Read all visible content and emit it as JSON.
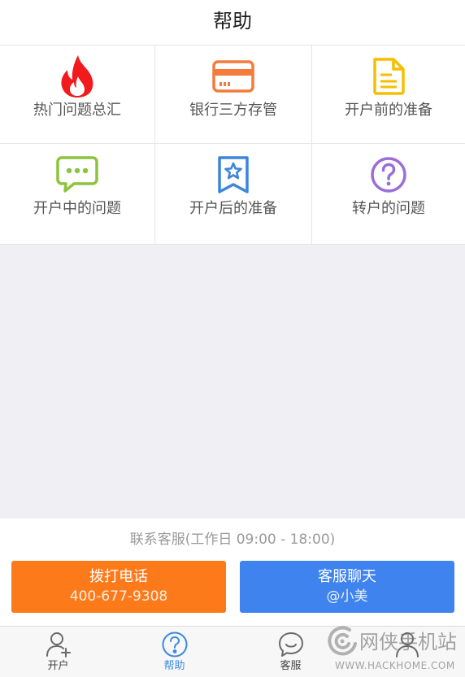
{
  "header": {
    "title": "帮助"
  },
  "categories": [
    {
      "label": "热门问题总汇",
      "icon": "fire-icon",
      "color": "#f21a1d"
    },
    {
      "label": "银行三方存管",
      "icon": "bank-card-icon",
      "color": "#f47b3c"
    },
    {
      "label": "开户前的准备",
      "icon": "document-icon",
      "color": "#f5bf00"
    },
    {
      "label": "开户中的问题",
      "icon": "chat-bubble-icon",
      "color": "#8cc43d"
    },
    {
      "label": "开户后的准备",
      "icon": "bookmark-star-icon",
      "color": "#3a86db"
    },
    {
      "label": "转户的问题",
      "icon": "question-circle-icon",
      "color": "#9a6ed8"
    }
  ],
  "contact": {
    "hours_text": "联系客服(工作日 09:00 - 18:00)",
    "call_button": {
      "title": "拨打电话",
      "subtitle": "400-677-9308",
      "color": "#fd7a1b"
    },
    "chat_button": {
      "title": "客服聊天",
      "subtitle": "@小美",
      "color": "#3f83ee"
    }
  },
  "tabbar": {
    "active_color": "#3a8ae6",
    "items": [
      {
        "label": "开户",
        "icon": "user-add-icon",
        "active": false
      },
      {
        "label": "帮助",
        "icon": "help-circle-icon",
        "active": true
      },
      {
        "label": "客服",
        "icon": "chat-smile-icon",
        "active": false
      },
      {
        "icon": "user-icon",
        "active": false
      }
    ]
  },
  "watermark": {
    "name": "网侠手机站",
    "url": "WWW.HACKHOME.COM"
  }
}
